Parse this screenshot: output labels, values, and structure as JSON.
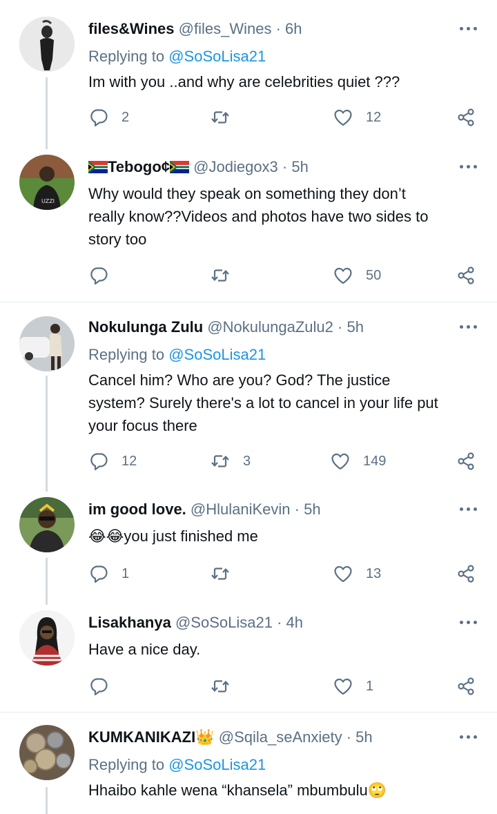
{
  "reply_prefix": "Replying to",
  "tweets": [
    {
      "name": "files&Wines",
      "handle": "@files_Wines",
      "time": "6h",
      "replying_to": "@SoSoLisa21",
      "text": "Im with you ..and why are celebrities quiet ???",
      "replies": "2",
      "retweets": "",
      "likes": "12"
    },
    {
      "name": "Tebogo¢",
      "handle": "@Jodiegox3",
      "time": "5h",
      "text_lines": [
        "Why would they speak on something they don’t",
        "really know??Videos and photos have two sides to",
        "story too"
      ],
      "replies": "",
      "retweets": "",
      "likes": "50"
    },
    {
      "name": "Nokulunga Zulu",
      "handle": "@NokulungaZulu2",
      "time": "5h",
      "replying_to": "@SoSoLisa21",
      "text_lines": [
        "Cancel him? Who are you? God? The justice",
        "system? Surely there's a lot to cancel in your life put",
        "your focus there"
      ],
      "replies": "12",
      "retweets": "3",
      "likes": "149"
    },
    {
      "name": "im good love.",
      "handle": "@HlulaniKevin",
      "time": "5h",
      "text": "you just finished me",
      "emoji_prefix": "😂😂",
      "replies": "1",
      "retweets": "",
      "likes": "13"
    },
    {
      "name": "Lisakhanya",
      "handle": "@SoSoLisa21",
      "time": "4h",
      "text": "Have a nice day.",
      "replies": "",
      "retweets": "",
      "likes": "1"
    },
    {
      "name": "KUMKANIKAZI",
      "name_emoji": "👑",
      "handle": "@Sqila_seAnxiety",
      "time": "5h",
      "replying_to": "@SoSoLisa21",
      "text": "Hhaibo kahle wena “khansela” mbumbulu",
      "text_emoji": "🙄",
      "replies": "",
      "retweets": "",
      "likes": ""
    }
  ],
  "colors": {
    "text": "#0f1419",
    "secondary": "#5b7083",
    "link": "#1b95e0",
    "separator": "#e6ecf0",
    "thread_line": "#d4dbe0"
  },
  "icons": [
    "reply-icon",
    "retweet-icon",
    "like-icon",
    "share-icon",
    "more-icon",
    "south-africa-flag-icon"
  ]
}
